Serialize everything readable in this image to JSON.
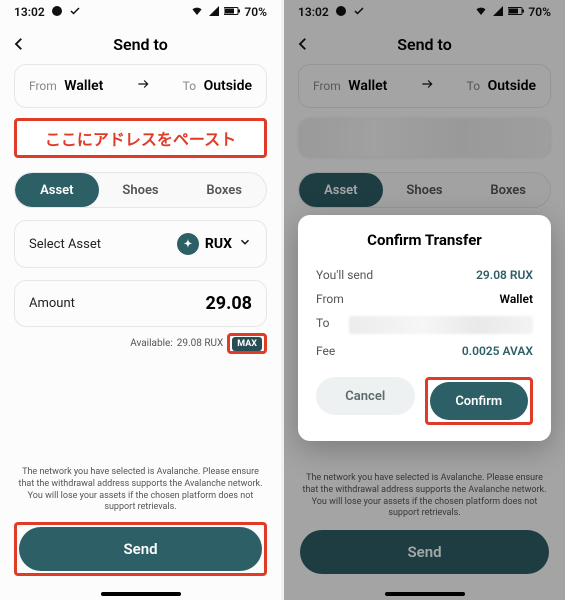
{
  "status": {
    "time": "13:02",
    "battery": "70%"
  },
  "header": {
    "title": "Send to"
  },
  "fromto": {
    "from_label": "From",
    "from_value": "Wallet",
    "to_label": "To",
    "to_value": "Outside"
  },
  "paste_hint": "ここにアドレスをペースト",
  "tabs": {
    "asset": "Asset",
    "shoes": "Shoes",
    "boxes": "Boxes"
  },
  "asset": {
    "select_label": "Select Asset",
    "symbol": "RUX",
    "amount_label": "Amount",
    "amount_value": "29.08",
    "available_prefix": "Available:",
    "available_value": "29.08 RUX",
    "max": "MAX"
  },
  "footnote": "The network you have selected is Avalanche. Please ensure that the withdrawal address supports the Avalanche network. You will lose your assets if the chosen platform does not support retrievals.",
  "send_label": "Send",
  "dialog": {
    "title": "Confirm Transfer",
    "youll_send_label": "You'll send",
    "youll_send_value": "29.08 RUX",
    "from_label": "From",
    "from_value": "Wallet",
    "to_label": "To",
    "fee_label": "Fee",
    "fee_value": "0.0025 AVAX",
    "cancel": "Cancel",
    "confirm": "Confirm"
  }
}
